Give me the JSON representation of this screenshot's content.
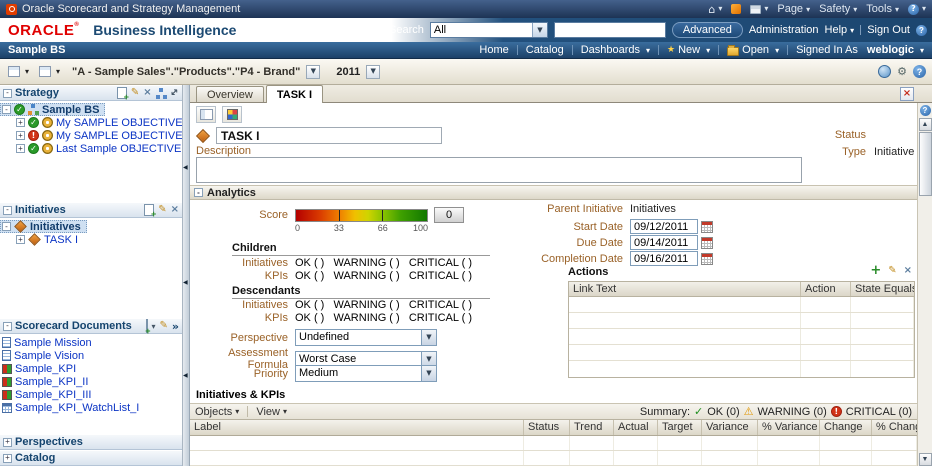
{
  "browser": {
    "window_title": "Oracle Scorecard and Strategy Management",
    "page_menu": "Page",
    "safety_menu": "Safety",
    "tools_menu": "Tools"
  },
  "header": {
    "logo": "ORACLE",
    "product": "Business Intelligence",
    "search_label": "Search",
    "search_scope": "All",
    "advanced": "Advanced",
    "administration": "Administration",
    "help": "Help",
    "sign_out": "Sign Out"
  },
  "navbar": {
    "scorecard": "Sample BS",
    "home": "Home",
    "catalog": "Catalog",
    "dashboards": "Dashboards",
    "new": "New",
    "open": "Open",
    "signed_in_as": "Signed In As",
    "user": "weblogic"
  },
  "pov": {
    "breadcrumb": "\"A - Sample Sales\".\"Products\".\"P4 - Brand\"",
    "year": "2011"
  },
  "sidebar": {
    "strategy": {
      "title": "Strategy",
      "items": [
        {
          "label": "Sample BS"
        },
        {
          "label": "My SAMPLE OBJECTIVE"
        },
        {
          "label": "My SAMPLE OBJECTIVE II"
        },
        {
          "label": "Last Sample OBJECTIVE"
        }
      ]
    },
    "initiatives": {
      "title": "Initiatives",
      "items": [
        {
          "label": "Initiatives"
        },
        {
          "label": "TASK I"
        }
      ]
    },
    "documents": {
      "title": "Scorecard Documents",
      "items": [
        {
          "label": "Sample Mission"
        },
        {
          "label": "Sample Vision"
        },
        {
          "label": "Sample_KPI"
        },
        {
          "label": "Sample_KPI_II"
        },
        {
          "label": "Sample_KPI_III"
        },
        {
          "label": "Sample_KPI_WatchList_I"
        }
      ]
    },
    "perspectives_title": "Perspectives",
    "catalog_title": "Catalog"
  },
  "main": {
    "tab_overview": "Overview",
    "tab_task": "TASK I",
    "detail": {
      "name": "TASK I",
      "status_label": "Status",
      "type_label": "Type",
      "type_value": "Initiative",
      "description_label": "Description"
    },
    "analytics": {
      "title": "Analytics",
      "score_label": "Score",
      "score_value": "0",
      "tick_0": "0",
      "tick_33": "33",
      "tick_66": "66",
      "tick_100": "100",
      "children": "Children",
      "descendants": "Descendants",
      "initiatives_label": "Initiatives",
      "kpis_label": "KPIs",
      "status_line": "OK ( )   WARNING ( )   CRITICAL ( )",
      "perspective_label": "Perspective",
      "perspective_value": "Undefined",
      "assessment_label": "Assessment Formula",
      "assessment_value": "Worst Case",
      "priority_label": "Priority",
      "priority_value": "Medium",
      "parent_label": "Parent Initiative",
      "parent_value": "Initiatives",
      "start_label": "Start Date",
      "start_value": "09/12/2011",
      "due_label": "Due Date",
      "due_value": "09/14/2011",
      "completion_label": "Completion Date",
      "completion_value": "09/16/2011",
      "actions_title": "Actions",
      "actions_cols": [
        "Link Text",
        "Action",
        "State Equals"
      ]
    },
    "grid": {
      "title": "Initiatives & KPIs",
      "objects_menu": "Objects",
      "view_menu": "View",
      "summary_label": "Summary:",
      "ok": "OK (0)",
      "warning": "WARNING (0)",
      "critical": "CRITICAL (0)",
      "columns": [
        "Label",
        "Status",
        "Trend",
        "Actual",
        "Target",
        "Variance",
        "% Variance",
        "Change",
        "% Change"
      ]
    }
  }
}
